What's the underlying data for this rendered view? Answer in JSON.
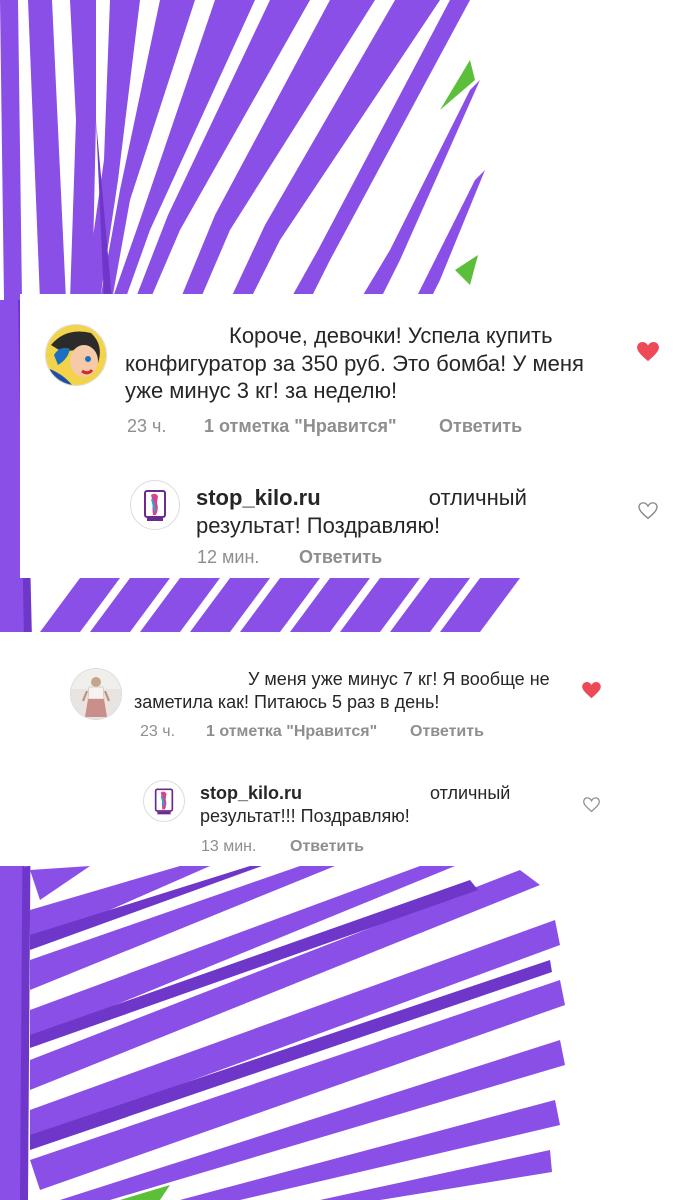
{
  "comments": [
    {
      "text": "Короче, девочки! Успела купить конфигуратор за 350 руб. Это бомба! У меня уже минус 3 кг! за неделю!",
      "time": "23 ч.",
      "likes": "1 отметка \"Нравится\"",
      "reply_label": "Ответить",
      "liked": true,
      "avatar_icon": "pop-art-woman-avatar",
      "reply": {
        "username": "stop_kilo.ru",
        "text": "отличный результат! Поздравляю!",
        "time": "12 мин.",
        "reply_label": "Ответить",
        "liked": false,
        "avatar_icon": "stop-kilo-logo-avatar"
      }
    },
    {
      "text": "У меня уже минус 7 кг! Я вообще не заметила как! Питаюсь 5 раз в день!",
      "time": "23 ч.",
      "likes": "1 отметка \"Нравится\"",
      "reply_label": "Ответить",
      "liked": true,
      "avatar_icon": "woman-photo-avatar",
      "reply": {
        "username": "stop_kilo.ru",
        "text": "отличный результат!!! Поздравляю!",
        "time": "13 мин.",
        "reply_label": "Ответить",
        "liked": false,
        "avatar_icon": "stop-kilo-logo-avatar"
      }
    }
  ],
  "colors": {
    "leaf_purple": "#8a4fe6",
    "leaf_dark": "#6e36c9",
    "leaf_green": "#5bbf3a",
    "heart_red": "#ed4956",
    "meta_gray": "#8e8e8e",
    "text": "#262626"
  }
}
